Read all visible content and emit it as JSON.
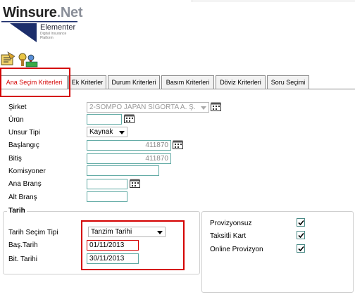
{
  "brand": {
    "name": "Winsure",
    "suffix": ".Net",
    "product": "Elementer",
    "tagline_1": "Digital Insurance",
    "tagline_2": "Platform"
  },
  "tabs": [
    {
      "label": "Ana Seçim Kriterleri",
      "active": true
    },
    {
      "label": "Ek Kriterler",
      "active": false
    },
    {
      "label": "Durum Kriterleri",
      "active": false
    },
    {
      "label": "Basım Kriterleri",
      "active": false
    },
    {
      "label": "Döviz Kriterleri",
      "active": false
    },
    {
      "label": "Soru Seçimi",
      "active": false
    }
  ],
  "form": {
    "sirket": {
      "label": "Şirket",
      "value": "2-SOMPO JAPAN SİGORTA A. Ş."
    },
    "urun": {
      "label": "Ürün",
      "value": ""
    },
    "unsur_tipi": {
      "label": "Unsur Tipi",
      "value": "Kaynak"
    },
    "baslangic": {
      "label": "Başlangıç",
      "value": "411870"
    },
    "bitis": {
      "label": "Bitiş",
      "value": "411870"
    },
    "komisyoner": {
      "label": "Komisyoner",
      "value": ""
    },
    "ana_brans": {
      "label": "Ana Branş",
      "value": ""
    },
    "alt_brans": {
      "label": "Alt Branş",
      "value": ""
    }
  },
  "tarih": {
    "legend": "Tarih",
    "secim_tipi": {
      "label": "Tarih Seçim Tipi",
      "value": "Tanzim Tarihi"
    },
    "bas_tarih": {
      "label": "Baş.Tarih",
      "value": "01/11/2013"
    },
    "bit_tarih": {
      "label": "Bit. Tarihi",
      "value": "30/11/2013"
    }
  },
  "options": [
    {
      "label": "Provizyonsuz",
      "checked": true
    },
    {
      "label": "Taksitli Kart",
      "checked": true
    },
    {
      "label": "Online Provizyon",
      "checked": true
    }
  ],
  "colors": {
    "highlight": "#d40000",
    "input_border": "#5fa9a3",
    "brand_blue": "#1c2e6b"
  }
}
